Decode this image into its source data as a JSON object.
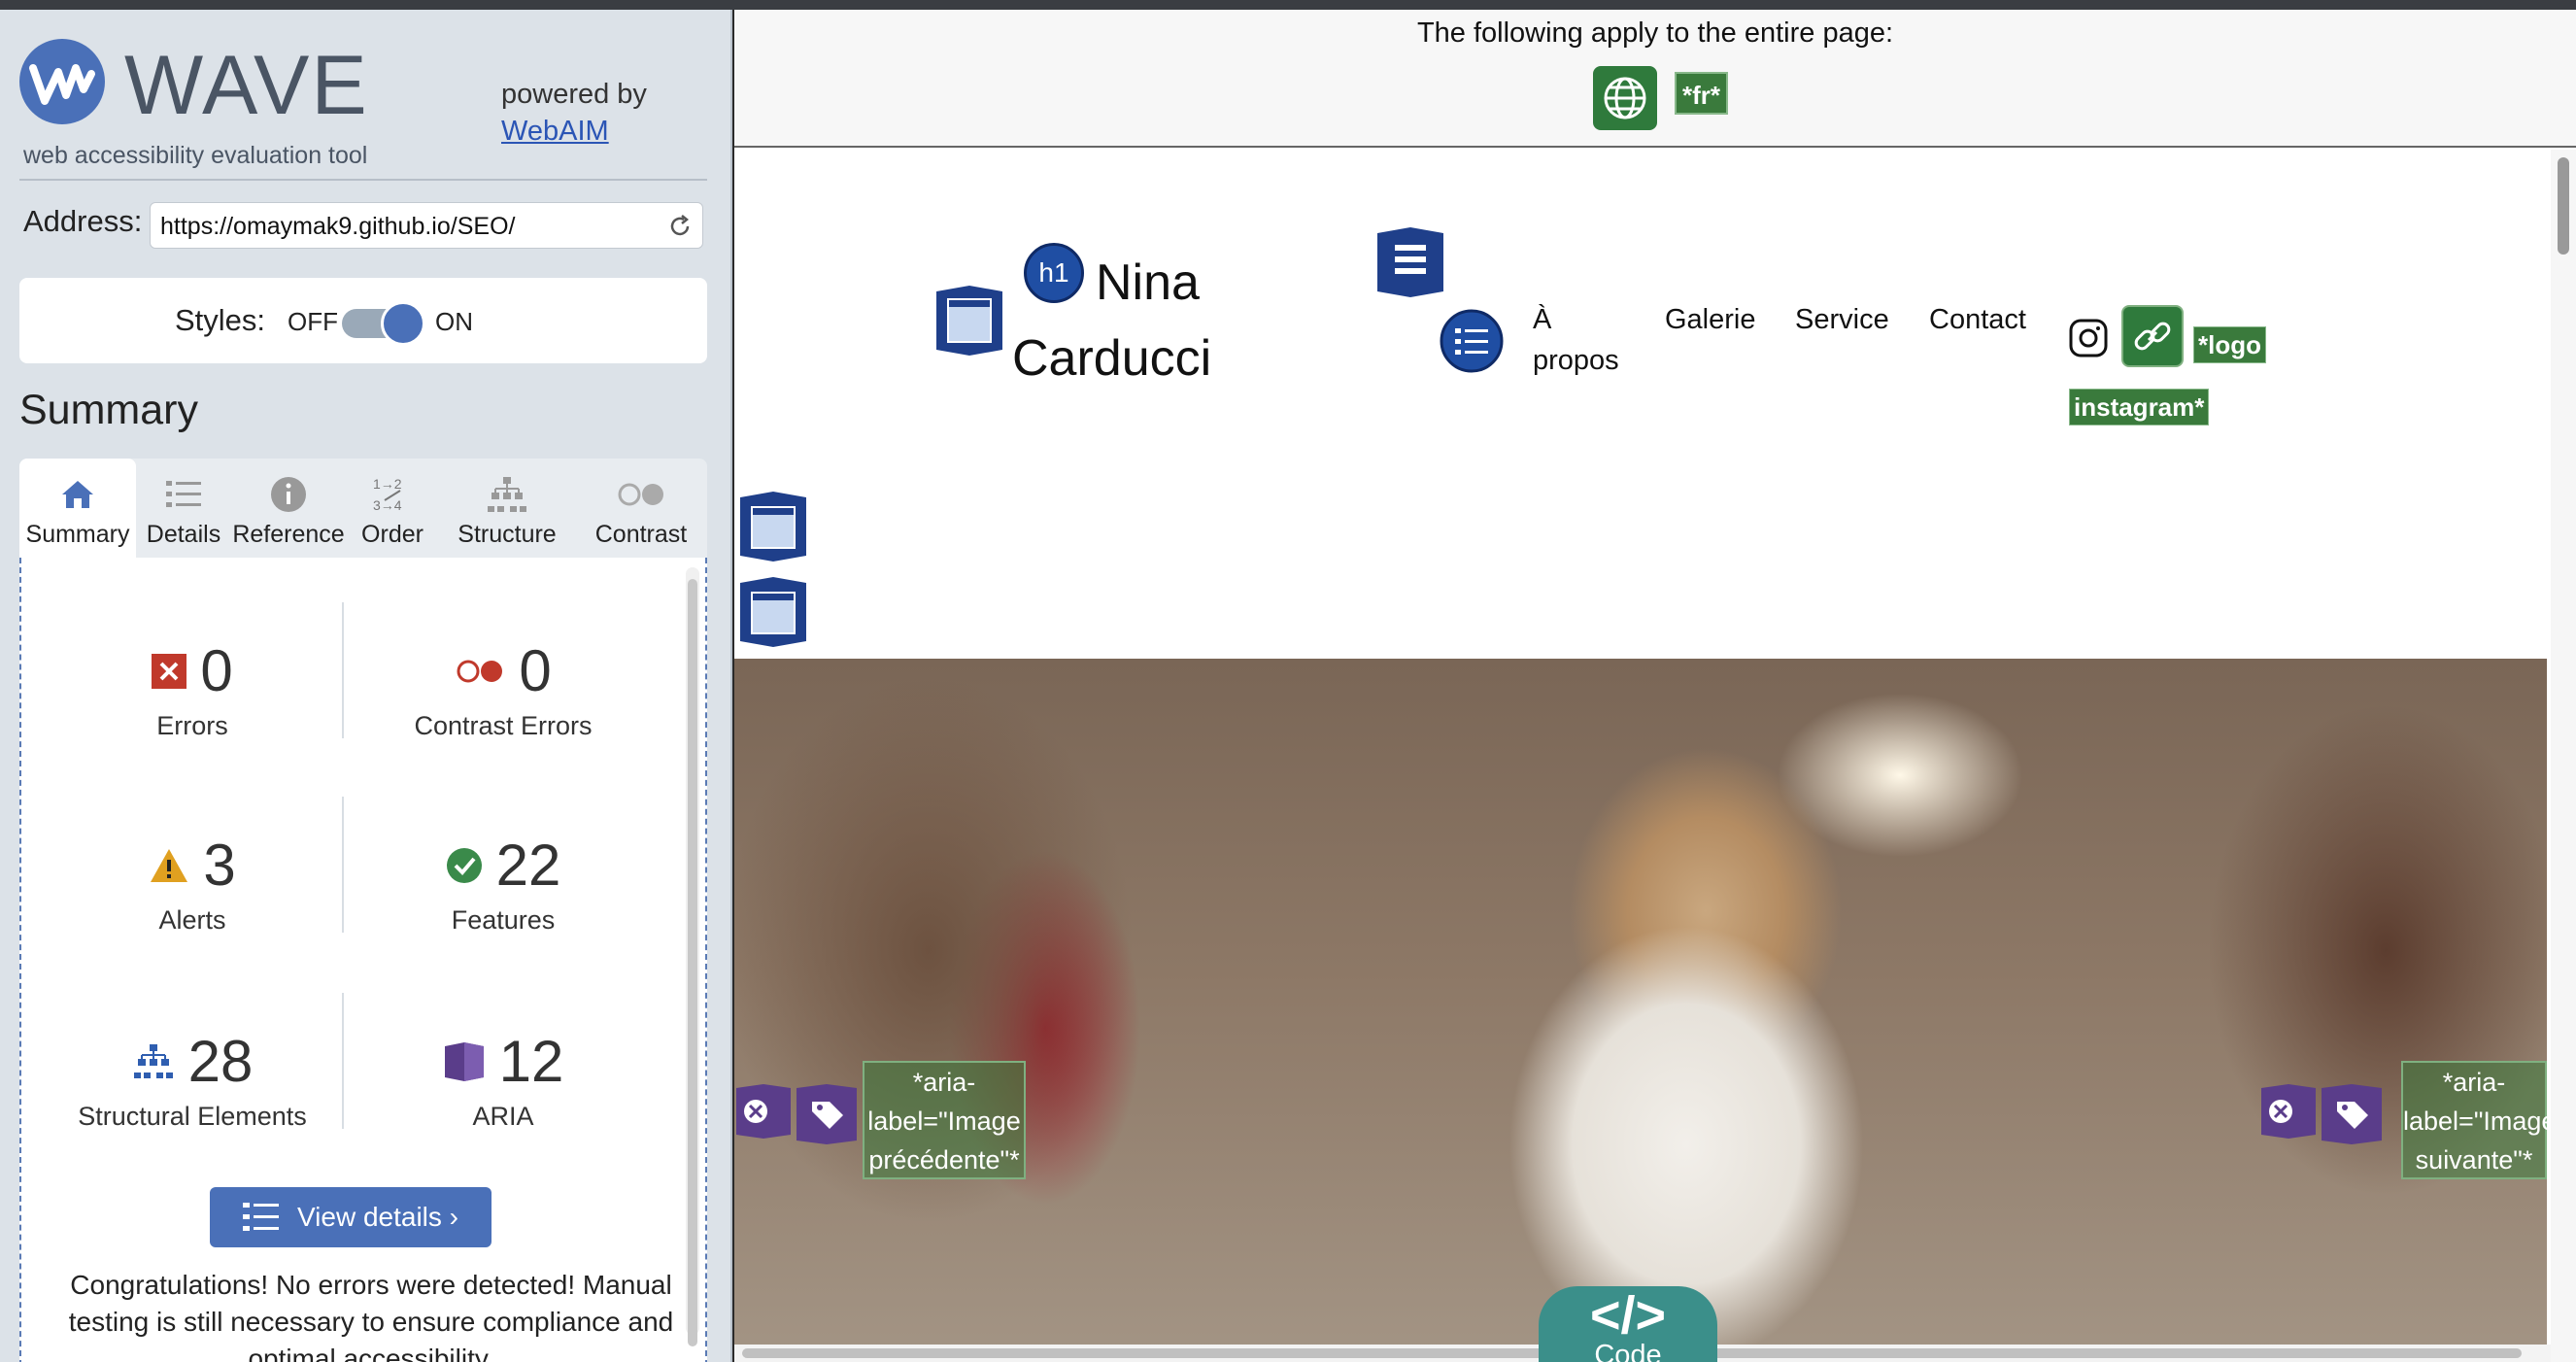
{
  "tool": {
    "name": "WAVE",
    "subtitle": "web accessibility evaluation tool",
    "powered_by": "powered by",
    "powered_link": "WebAIM"
  },
  "address": {
    "label": "Address:",
    "value": "https://omaymak9.github.io/SEO/"
  },
  "styles": {
    "label": "Styles:",
    "off": "OFF",
    "on": "ON",
    "state": "on"
  },
  "summary": {
    "heading": "Summary",
    "tabs": [
      {
        "label": "Summary",
        "icon": "home-icon",
        "active": true
      },
      {
        "label": "Details",
        "icon": "list-icon"
      },
      {
        "label": "Reference",
        "icon": "info-icon"
      },
      {
        "label": "Order",
        "icon": "order-icon"
      },
      {
        "label": "Structure",
        "icon": "structure-icon"
      },
      {
        "label": "Contrast",
        "icon": "contrast-icon"
      }
    ],
    "stats": {
      "errors": {
        "count": "0",
        "label": "Errors"
      },
      "contrast": {
        "count": "0",
        "label": "Contrast Errors"
      },
      "alerts": {
        "count": "3",
        "label": "Alerts"
      },
      "features": {
        "count": "22",
        "label": "Features"
      },
      "structural": {
        "count": "28",
        "label": "Structural Elements"
      },
      "aria": {
        "count": "12",
        "label": "ARIA"
      }
    },
    "view_details": "View details ›",
    "congrats": "Congratulations! No errors were detected! Manual testing is still necessary to ensure compliance and optimal accessibility."
  },
  "page": {
    "apply_text": "The following apply to the entire page:",
    "lang_tag": "*fr*",
    "h1_badge": "h1",
    "brand_line1": "Nina",
    "brand_line2": "Carducci",
    "nav": [
      "À propos",
      "Galerie",
      "Service",
      "Contact"
    ],
    "logo_alt": "*logo",
    "logo_alt2": "instagram*",
    "prev_label": "*aria-label=\"Image précédente\"*",
    "next_label": "*aria-label=\"Image suivante\"*",
    "code_label": "Code",
    "code_symbol": "</>"
  },
  "colors": {
    "brand": "#4a70b8",
    "feature_green": "#3a7a3c",
    "error_red": "#c0392b",
    "alert_orange": "#e0a020",
    "aria_purple": "#5a3d8a",
    "code_teal": "#3b8f8a"
  }
}
